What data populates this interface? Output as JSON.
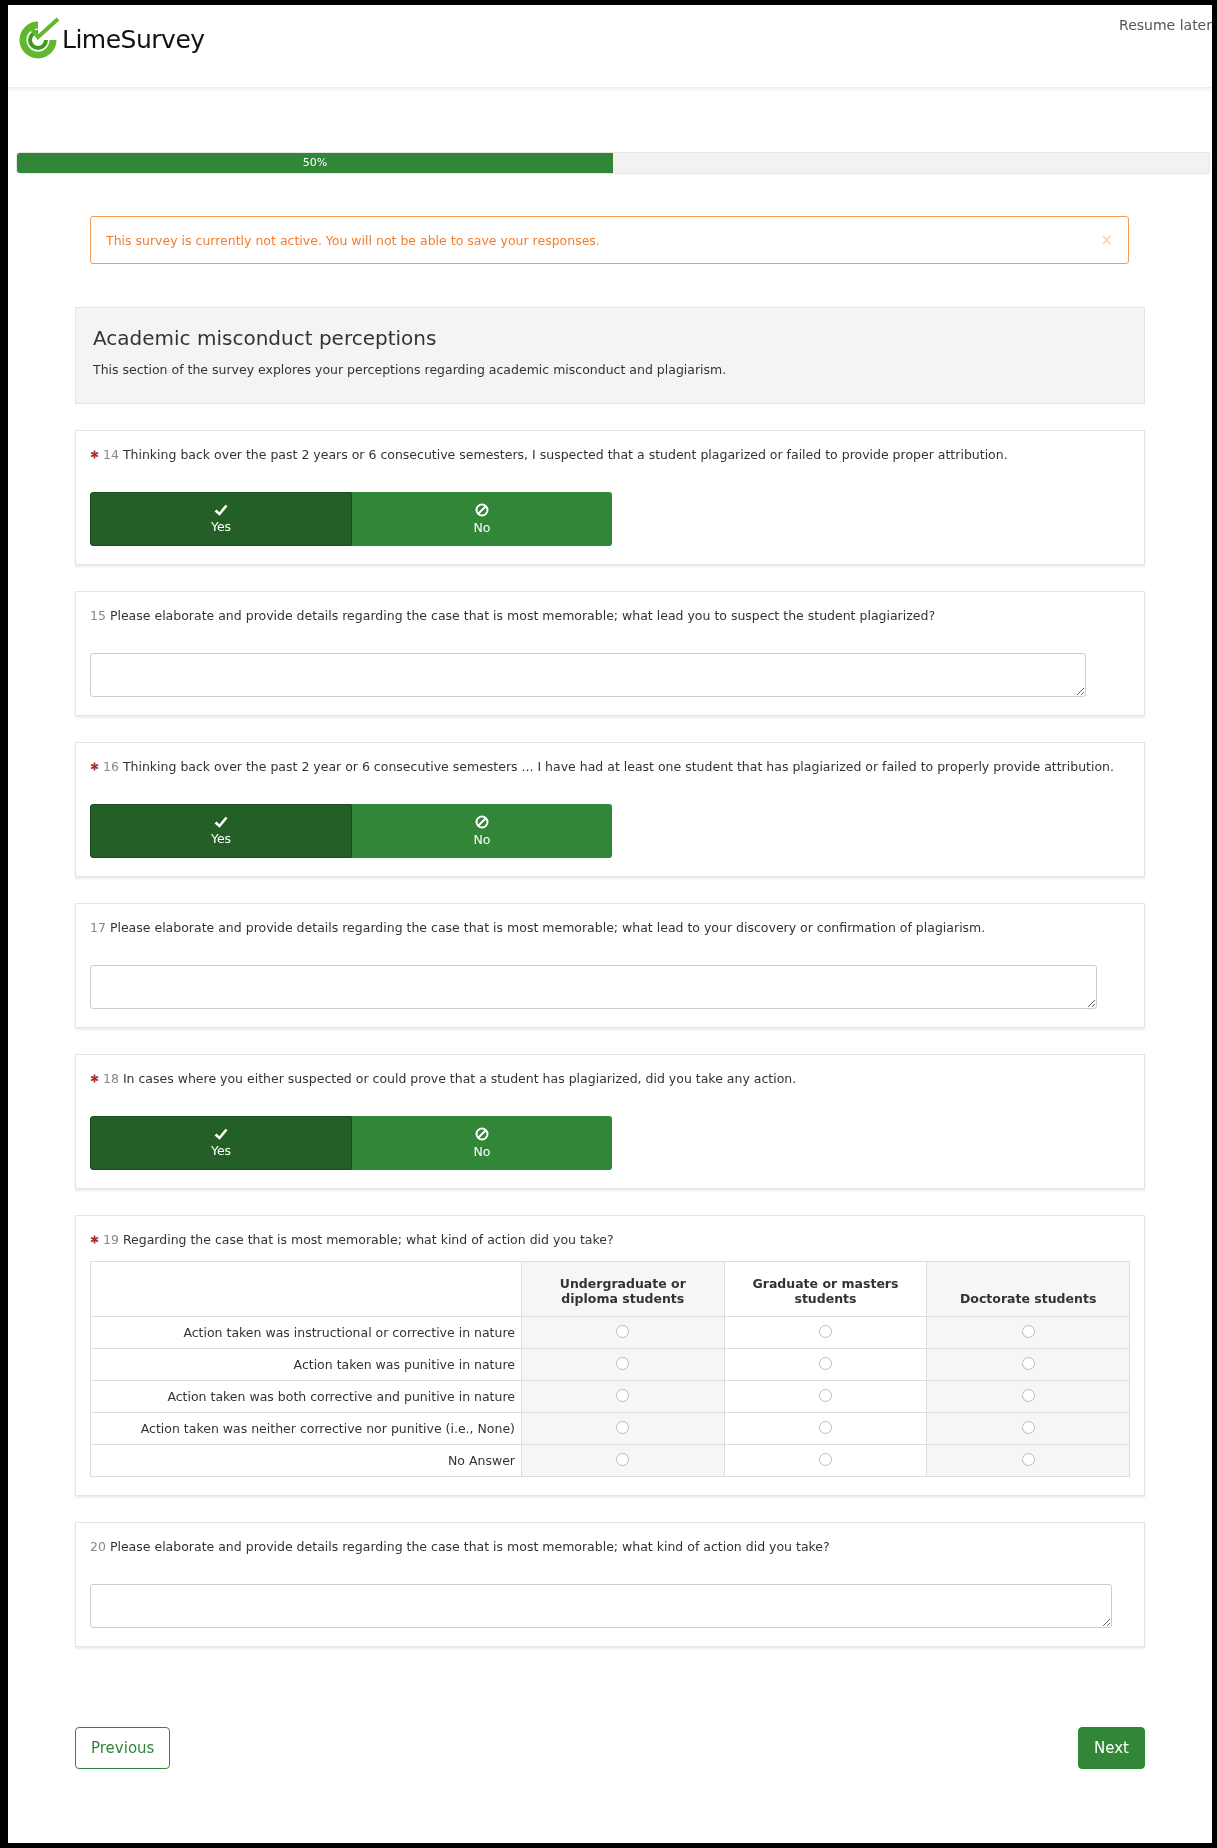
{
  "header": {
    "logo_text": "LimeSurvey",
    "resume_link": "Resume later"
  },
  "progress": {
    "level": 0.5,
    "label": "50%"
  },
  "alert": {
    "message": "This survey is currently not active. You will not be able to save your responses.",
    "close": "×"
  },
  "group": {
    "title": "Academic misconduct perceptions",
    "description": "This section of the survey explores your perceptions regarding academic misconduct and plagiarism."
  },
  "questions": [
    {
      "kind": "yesno",
      "mandatory": true,
      "number": "14",
      "text": "Thinking back over the past 2 years or 6 consecutive semesters, I suspected that a student plagarized or failed to provide proper attribution.",
      "options": [
        {
          "label": "Yes",
          "selected": true
        },
        {
          "label": "No",
          "selected": false
        }
      ]
    },
    {
      "kind": "text",
      "mandatory": false,
      "number": "15",
      "text": "Please elaborate and provide details regarding the case that is most memorable; what lead you to suspect the student plagiarized?"
    },
    {
      "kind": "yesno",
      "mandatory": true,
      "number": "16",
      "text": "Thinking back over the past 2 year or 6 consecutive semesters ... I have had at least one student that has plagiarized or failed to properly provide attribution.",
      "options": [
        {
          "label": "Yes",
          "selected": true
        },
        {
          "label": "No",
          "selected": false
        }
      ]
    },
    {
      "kind": "text",
      "mandatory": false,
      "number": "17",
      "text": "Please elaborate and provide details regarding the case that is most memorable; what lead to your discovery or confirmation of plagiarism."
    },
    {
      "kind": "yesno",
      "mandatory": true,
      "number": "18",
      "text": "In cases where you either suspected or could prove that a student has plagiarized, did you take any action.",
      "options": [
        {
          "label": "Yes",
          "selected": true
        },
        {
          "label": "No",
          "selected": false
        }
      ]
    },
    {
      "kind": "matrix",
      "mandatory": true,
      "number": "19",
      "text": "Regarding the case that is most memorable; what kind of action did you take?",
      "columns": [
        "Undergraduate or diploma students",
        "Graduate or masters students",
        "Doctorate students"
      ],
      "rows": [
        {
          "label": "Action taken was instructional or corrective in nature",
          "checked": [
            false,
            false,
            false
          ]
        },
        {
          "label": "Action taken was punitive in nature",
          "checked": [
            false,
            false,
            false
          ]
        },
        {
          "label": "Action taken was both corrective and punitive in nature",
          "checked": [
            false,
            false,
            false
          ]
        },
        {
          "label": "Action taken was neither corrective nor punitive (i.e., None)",
          "checked": [
            false,
            false,
            false
          ]
        },
        {
          "label": "No Answer",
          "checked": [
            false,
            false,
            false
          ]
        }
      ]
    },
    {
      "kind": "text",
      "mandatory": false,
      "number": "20",
      "text": "Please elaborate and provide details regarding the case that is most memorable; what kind of action did you take?"
    }
  ],
  "navigation": {
    "previous": "Previous",
    "next": "Next"
  }
}
